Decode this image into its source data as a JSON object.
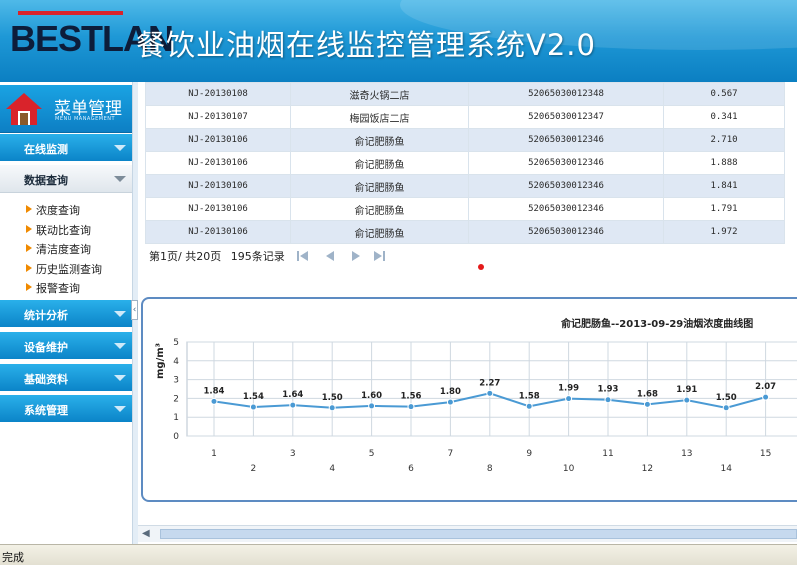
{
  "header": {
    "logo": "BESTLAN",
    "title": "餐饮业油烟在线监控管理系统V2.0"
  },
  "sidebar": {
    "menu_title": "菜单管理",
    "menu_subtitle": "MENU MANAGEMENT",
    "sections": [
      {
        "label": "在线监测"
      },
      {
        "label": "数据查询",
        "items": [
          "浓度查询",
          "联动比查询",
          "清洁度查询",
          "历史监测查询",
          "报警查询"
        ]
      },
      {
        "label": "统计分析"
      },
      {
        "label": "设备维护"
      },
      {
        "label": "基础资料"
      },
      {
        "label": "系统管理"
      }
    ]
  },
  "table": {
    "rows": [
      [
        "NJ-20130108",
        "滋奇火锅二店",
        "52065030012348",
        "0.567"
      ],
      [
        "NJ-20130107",
        "梅园饭店二店",
        "52065030012347",
        "0.341"
      ],
      [
        "NJ-20130106",
        "俞记肥肠鱼",
        "52065030012346",
        "2.710"
      ],
      [
        "NJ-20130106",
        "俞记肥肠鱼",
        "52065030012346",
        "1.888"
      ],
      [
        "NJ-20130106",
        "俞记肥肠鱼",
        "52065030012346",
        "1.841"
      ],
      [
        "NJ-20130106",
        "俞记肥肠鱼",
        "52065030012346",
        "1.791"
      ],
      [
        "NJ-20130106",
        "俞记肥肠鱼",
        "52065030012346",
        "1.972"
      ]
    ]
  },
  "pager": {
    "page_info": "第1页/ 共20页",
    "record_count": "195条记录"
  },
  "chart_data": {
    "type": "line",
    "title": "俞记肥肠鱼--2013-09-29油烟浓度曲线图",
    "ylabel": "mg/m³",
    "xlabel": "",
    "ylim": [
      0,
      5
    ],
    "yticks": [
      0,
      1,
      2,
      3,
      4,
      5
    ],
    "grid": true,
    "x": [
      1,
      2,
      3,
      4,
      5,
      6,
      7,
      8,
      9,
      10,
      11,
      12,
      13,
      14,
      15
    ],
    "values": [
      1.84,
      1.54,
      1.64,
      1.5,
      1.6,
      1.56,
      1.8,
      2.27,
      1.58,
      1.99,
      1.93,
      1.68,
      1.91,
      1.5,
      2.07
    ],
    "line_color": "#4a9ad4"
  },
  "status": {
    "text": "完成"
  }
}
